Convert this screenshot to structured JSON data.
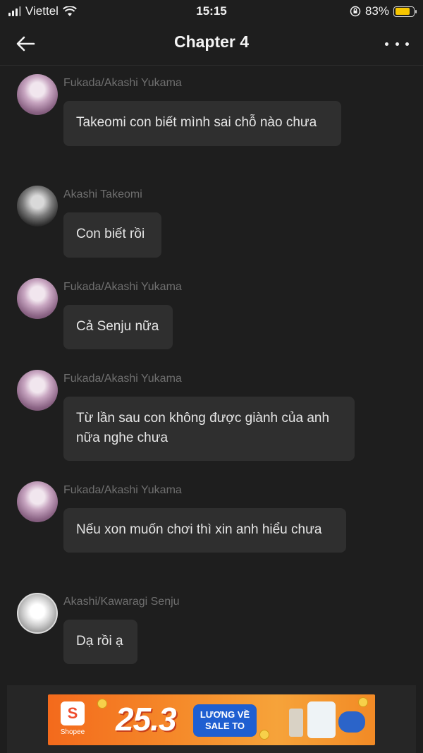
{
  "status_bar": {
    "carrier": "Viettel",
    "time": "15:15",
    "battery_percent": "83%",
    "battery_level": 0.83
  },
  "nav": {
    "title": "Chapter 4"
  },
  "messages": [
    {
      "sender": "Fukada/Akashi Yukama",
      "text": "Takeomi con biết mình sai chỗ nào chưa"
    },
    {
      "sender": "Akashi Takeomi",
      "text": "Con biết rồi"
    },
    {
      "sender": "Fukada/Akashi Yukama",
      "text": "Cả Senju nữa"
    },
    {
      "sender": "Fukada/Akashi Yukama",
      "text_line1": "Từ lần sau con không được giành của anh",
      "text_line2": "nữa nghe chưa"
    },
    {
      "sender": "Fukada/Akashi Yukama",
      "text": "Nếu xon muốn chơi thì xin anh hiểu chưa"
    },
    {
      "sender": "Akashi/Kawaragi Senju",
      "text": "Dạ rồi ạ"
    }
  ],
  "ad": {
    "brand": "Shopee",
    "brand_letter": "S",
    "date": "25.3",
    "tag_line1": "LƯƠNG VỀ",
    "tag_line2": "SALE TO"
  },
  "colors": {
    "background": "#1e1e1e",
    "bubble": "#2f2f2f",
    "sender_text": "#6f6f6f",
    "battery": "#f7c600",
    "ad_orange": "#f36a1c"
  }
}
